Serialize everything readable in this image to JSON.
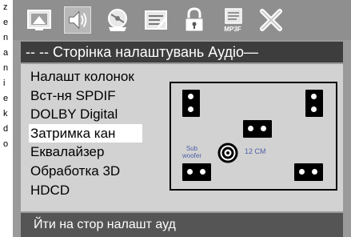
{
  "edge_text": [
    "z",
    "e",
    "n",
    "a",
    "n",
    "i",
    "e",
    "k",
    "d",
    "o"
  ],
  "toolbar": {
    "icons": [
      {
        "name": "general-setup-icon"
      },
      {
        "name": "audio-setup-icon"
      },
      {
        "name": "video-setup-icon"
      },
      {
        "name": "preference-setup-icon"
      },
      {
        "name": "password-lock-icon"
      },
      {
        "name": "mp3-setup-icon",
        "text": "MP3F"
      },
      {
        "name": "exit-icon"
      }
    ],
    "active_index": 1
  },
  "title": "-- -- Сторінка налаштувань Аудіо—",
  "menu": {
    "items": [
      "Налашт колонок",
      "Вст-ня SPDIF",
      "DOLBY Digital",
      "Затримка кан",
      "Еквалайзер",
      "Обработка 3D",
      "HDCD"
    ],
    "selected_index": 3
  },
  "speaker_diagram": {
    "subwoofer_label": "Sub\nwoofer",
    "distance_label": "12 CM"
  },
  "status": "Йти на стор налашт ауд",
  "colors": {
    "background": "#9a9a9a",
    "panel": "#d2d2d2",
    "title_bar": "#3d3d3d",
    "status_bar": "#555555",
    "selected_item": "#ffffff",
    "diagram_label": "#5060a8"
  }
}
